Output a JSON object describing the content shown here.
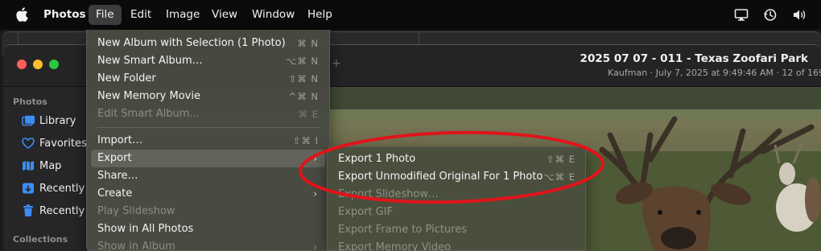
{
  "menubar": {
    "app_name": "Photos",
    "items": [
      "File",
      "Edit",
      "Image",
      "View",
      "Window",
      "Help"
    ],
    "status_icons": [
      "display-icon",
      "history-icon",
      "volume-icon"
    ]
  },
  "window": {
    "title": "2025 07 07 - 011 - Texas Zoofari Park",
    "subtitle": "Kaufman  ·  July 7, 2025 at 9:49:46 AM  ·  12 of 169"
  },
  "sidebar": {
    "section_photos": "Photos",
    "items": [
      {
        "label": "Library",
        "icon": "library-icon"
      },
      {
        "label": "Favorites",
        "icon": "heart-icon"
      },
      {
        "label": "Map",
        "icon": "map-icon"
      },
      {
        "label": "Recently",
        "icon": "recently-saved-icon"
      },
      {
        "label": "Recently",
        "icon": "trash-icon"
      }
    ],
    "section_collections": "Collections"
  },
  "file_menu": {
    "items": [
      {
        "label": "New Album with Selection (1 Photo)",
        "shortcut": "⌘ N",
        "enabled": true
      },
      {
        "label": "New Smart Album…",
        "shortcut": "⌥⌘ N",
        "enabled": true
      },
      {
        "label": "New Folder",
        "shortcut": "⇧⌘ N",
        "enabled": true
      },
      {
        "label": "New Memory Movie",
        "shortcut": "^⌘ N",
        "enabled": true
      },
      {
        "label": "Edit Smart Album…",
        "shortcut": "⌘ E",
        "enabled": false
      },
      {
        "label": "Import…",
        "shortcut": "⇧⌘ I",
        "enabled": true
      },
      {
        "label": "Export",
        "shortcut": "",
        "enabled": true,
        "submenu": true
      },
      {
        "label": "Share…",
        "shortcut": "",
        "enabled": true
      },
      {
        "label": "Create",
        "shortcut": "",
        "enabled": true,
        "submenu": true
      },
      {
        "label": "Play Slideshow",
        "shortcut": "",
        "enabled": false
      },
      {
        "label": "Show in All Photos",
        "shortcut": "",
        "enabled": true
      },
      {
        "label": "Show in Album",
        "shortcut": "",
        "enabled": false,
        "submenu": true
      }
    ]
  },
  "export_submenu": {
    "items": [
      {
        "label": "Export 1 Photo",
        "shortcut": "⇧⌘ E",
        "enabled": true
      },
      {
        "label": "Export Unmodified Original For 1 Photo",
        "shortcut": "⌥⌘ E",
        "enabled": true
      },
      {
        "label": "Export Slideshow…",
        "shortcut": "",
        "enabled": false
      },
      {
        "label": "Export GIF",
        "shortcut": "",
        "enabled": false
      },
      {
        "label": "Export Frame to Pictures",
        "shortcut": "",
        "enabled": false
      },
      {
        "label": "Export Memory Video",
        "shortcut": "",
        "enabled": false
      }
    ]
  },
  "colors": {
    "annotation": "#e0141a",
    "accent": "#3b8ef5"
  }
}
